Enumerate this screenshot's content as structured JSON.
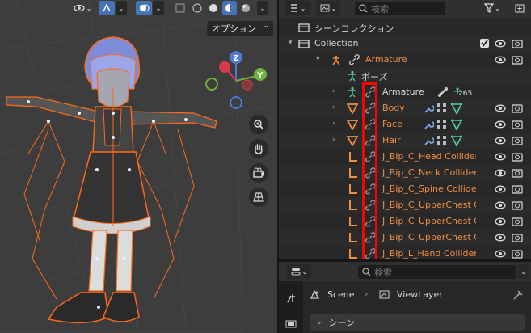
{
  "viewport": {
    "options_label": "オプション",
    "nav_gizmo": {
      "x": "X",
      "y": "Y",
      "z": "Z"
    }
  },
  "outliner": {
    "search_placeholder": "検索",
    "rows": [
      {
        "label": "シーンコレクション"
      },
      {
        "label": "Collection"
      },
      {
        "label": "Armature"
      },
      {
        "label": "ポーズ"
      },
      {
        "label": "Armature",
        "badge": "265"
      },
      {
        "label": "Body"
      },
      {
        "label": "Face"
      },
      {
        "label": "Hair"
      },
      {
        "label": "J_Bip_C_Head Collider"
      },
      {
        "label": "J_Bip_C_Neck Collider"
      },
      {
        "label": "J_Bip_C_Spine Collider"
      },
      {
        "label": "J_Bip_C_UpperChest Collider"
      },
      {
        "label": "J_Bip_C_UpperChest Collider"
      },
      {
        "label": "J_Bip_C_UpperChest Collider"
      },
      {
        "label": "J_Bip_L_Hand Collider"
      }
    ]
  },
  "properties": {
    "search_placeholder": "検索",
    "breadcrumb": {
      "scene": "Scene",
      "view_layer": "ViewLayer"
    },
    "section": "シーン"
  },
  "colors": {
    "accent": "#4772b3",
    "orange": "#f08e42",
    "highlight": "#ff0000"
  }
}
